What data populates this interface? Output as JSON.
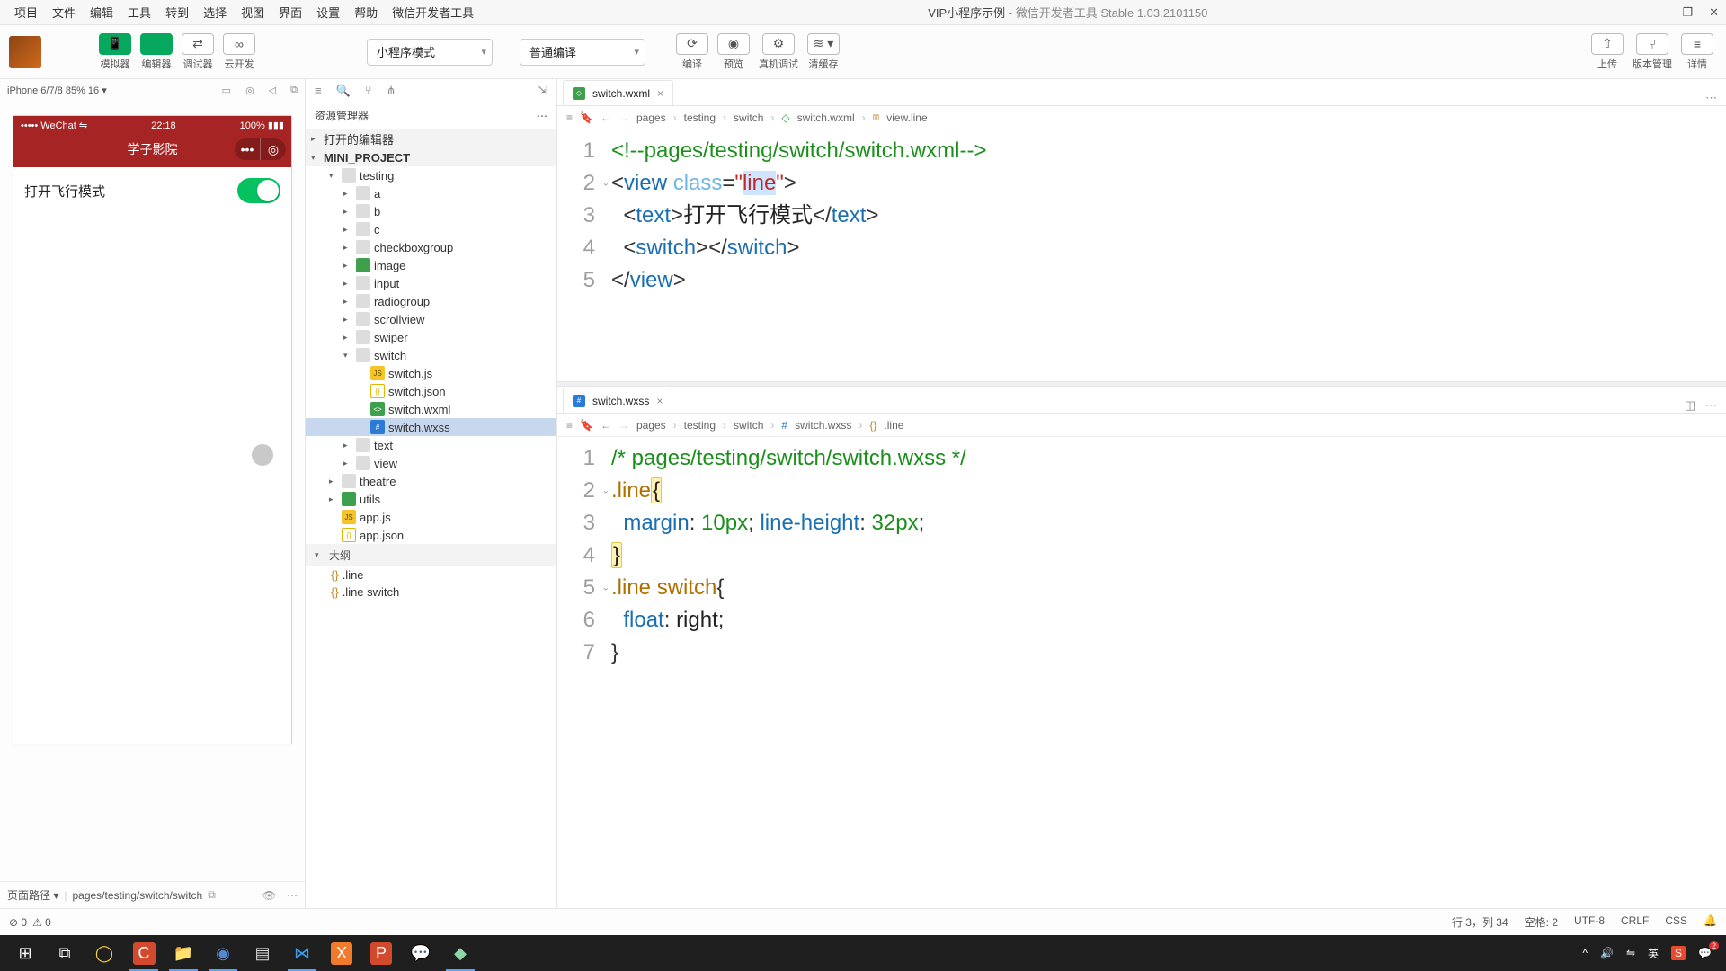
{
  "menu": {
    "items": [
      "项目",
      "文件",
      "编辑",
      "工具",
      "转到",
      "选择",
      "视图",
      "界面",
      "设置",
      "帮助",
      "微信开发者工具"
    ],
    "title_project": "VIP小程序示例",
    "title_suffix": " - 微信开发者工具 Stable 1.03.2101150"
  },
  "win": {
    "min": "—",
    "max": "❐",
    "close": "✕"
  },
  "toolbar": {
    "group1": [
      {
        "name": "simulator",
        "label": "模拟器",
        "icon": "📱",
        "green": true
      },
      {
        "name": "editor",
        "label": "编辑器",
        "icon": "</>",
        "green": true
      },
      {
        "name": "debugger",
        "label": "调试器",
        "icon": "⇄",
        "green": false
      },
      {
        "name": "cloud",
        "label": "云开发",
        "icon": "∞",
        "green": false
      }
    ],
    "mode": "小程序模式",
    "compile": "普通编译",
    "group2": [
      {
        "name": "compile",
        "label": "编译",
        "icon": "⟳"
      },
      {
        "name": "preview",
        "label": "预览",
        "icon": "◉"
      },
      {
        "name": "remote-debug",
        "label": "真机调试",
        "icon": "⚙"
      },
      {
        "name": "clear-cache",
        "label": "清缓存",
        "icon": "≋ ▾"
      }
    ],
    "group3": [
      {
        "name": "upload",
        "label": "上传",
        "icon": "⇧"
      },
      {
        "name": "version",
        "label": "版本管理",
        "icon": "⑂"
      },
      {
        "name": "detail",
        "label": "详情",
        "icon": "≡"
      }
    ]
  },
  "sim": {
    "device": "iPhone 6/7/8 85% 16 ▾",
    "icons": [
      "▭",
      "◎",
      "◁",
      "⧉"
    ],
    "status_left": "••••• WeChat ⇋",
    "status_time": "22:18",
    "status_right": "100% ▮▮▮",
    "app_title": "学子影院",
    "line_text": "打开飞行模式",
    "path_label": "页面路径 ▾",
    "path": "pages/testing/switch/switch"
  },
  "explorer": {
    "title": "资源管理器",
    "sections": {
      "open_editors": "打开的编辑器",
      "project": "MINI_PROJECT",
      "outline": "大纲"
    },
    "tree": [
      {
        "d": 1,
        "chev": "▾",
        "ic": "folder",
        "t": "testing"
      },
      {
        "d": 2,
        "chev": "▸",
        "ic": "folder",
        "t": "a"
      },
      {
        "d": 2,
        "chev": "▸",
        "ic": "folder",
        "t": "b"
      },
      {
        "d": 2,
        "chev": "▸",
        "ic": "folder",
        "t": "c"
      },
      {
        "d": 2,
        "chev": "▸",
        "ic": "folder",
        "t": "checkboxgroup"
      },
      {
        "d": 2,
        "chev": "▸",
        "ic": "fold-g",
        "t": "image"
      },
      {
        "d": 2,
        "chev": "▸",
        "ic": "folder",
        "t": "input"
      },
      {
        "d": 2,
        "chev": "▸",
        "ic": "folder",
        "t": "radiogroup"
      },
      {
        "d": 2,
        "chev": "▸",
        "ic": "folder",
        "t": "scrollview"
      },
      {
        "d": 2,
        "chev": "▸",
        "ic": "folder",
        "t": "swiper"
      },
      {
        "d": 2,
        "chev": "▾",
        "ic": "folder",
        "t": "switch"
      },
      {
        "d": 3,
        "chev": "",
        "ic": "js",
        "t": "switch.js"
      },
      {
        "d": 3,
        "chev": "",
        "ic": "json",
        "t": "switch.json"
      },
      {
        "d": 3,
        "chev": "",
        "ic": "wxml",
        "t": "switch.wxml"
      },
      {
        "d": 3,
        "chev": "",
        "ic": "wxss",
        "t": "switch.wxss",
        "sel": true
      },
      {
        "d": 2,
        "chev": "▸",
        "ic": "folder",
        "t": "text"
      },
      {
        "d": 2,
        "chev": "▸",
        "ic": "folder",
        "t": "view"
      },
      {
        "d": 1,
        "chev": "▸",
        "ic": "folder",
        "t": "theatre"
      },
      {
        "d": 1,
        "chev": "▸",
        "ic": "fold-g",
        "t": "utils"
      },
      {
        "d": 1,
        "chev": "",
        "ic": "js",
        "t": "app.js"
      },
      {
        "d": 1,
        "chev": "",
        "ic": "json",
        "t": "app.json"
      }
    ],
    "outline": [
      {
        "ic": "{}",
        "t": ".line"
      },
      {
        "ic": "{}",
        "t": ".line switch"
      }
    ]
  },
  "editor1": {
    "tab": "switch.wxml",
    "crumbs": [
      "pages",
      "testing",
      "switch",
      "switch.wxml",
      "view.line"
    ],
    "code": [
      {
        "n": 1,
        "h": "<span class='tok-com'>&lt;!--pages/testing/switch/switch.wxml--&gt;</span>"
      },
      {
        "n": 2,
        "fold": "⌄",
        "h": "<span class='tok-punct'>&lt;</span><span class='tok-tag'>view</span> <span class='tok-attr'>class</span><span class='tok-punct'>=</span><span class='tok-str'>\"<span class='hl-sel'>line</span>\"</span><span class='tok-punct'>&gt;</span>"
      },
      {
        "n": 3,
        "h": "  <span class='tok-punct'>&lt;</span><span class='tok-tag'>text</span><span class='tok-punct'>&gt;</span><span class='tok-txt'>打开飞行模式</span><span class='tok-punct'>&lt;/</span><span class='tok-tag'>text</span><span class='tok-punct'>&gt;</span>"
      },
      {
        "n": 4,
        "h": "  <span class='tok-punct'>&lt;</span><span class='tok-tag'>switch</span><span class='tok-punct'>&gt;&lt;/</span><span class='tok-tag'>switch</span><span class='tok-punct'>&gt;</span>"
      },
      {
        "n": 5,
        "h": "<span class='tok-punct'>&lt;/</span><span class='tok-tag'>view</span><span class='tok-punct'>&gt;</span>"
      }
    ]
  },
  "editor2": {
    "tab": "switch.wxss",
    "crumbs": [
      "pages",
      "testing",
      "switch",
      "switch.wxss",
      ".line"
    ],
    "code": [
      {
        "n": 1,
        "h": "<span class='tok-com'>/* pages/testing/switch/switch.wxss */</span>"
      },
      {
        "n": 2,
        "fold": "⌄",
        "h": "<span class='tok-sel'>.line</span><span class='hl-y'>{</span>"
      },
      {
        "n": 3,
        "h": "  <span class='tok-prop'>margin</span><span class='tok-punct'>:</span> <span class='tok-num'>10px</span><span class='tok-punct'>;</span> <span class='tok-prop'>line-height</span><span class='tok-punct'>:</span> <span class='tok-num'>32px</span><span class='tok-punct'>;</span>"
      },
      {
        "n": 4,
        "h": "<span class='hl-y'>}</span>"
      },
      {
        "n": 5,
        "fold": "⌄",
        "h": "<span class='tok-sel'>.line</span> <span class='tok-sel'>switch</span><span class='tok-brace'>{</span>"
      },
      {
        "n": 6,
        "h": "  <span class='tok-prop'>float</span><span class='tok-punct'>:</span> <span class='tok-txt'>right</span><span class='tok-punct'>;</span>"
      },
      {
        "n": 7,
        "h": "<span class='tok-brace'>}</span>"
      }
    ]
  },
  "status_exp": {
    "err": "⊘ 0",
    "warn": "⚠ 0"
  },
  "status_ed": {
    "pos": "行 3，列 34",
    "spaces": "空格: 2",
    "enc": "UTF-8",
    "eol": "CRLF",
    "lang": "CSS",
    "bell": "🔔"
  },
  "taskbar": {
    "items": [
      {
        "name": "start",
        "glyph": "⊞",
        "c": "#fff"
      },
      {
        "name": "taskview",
        "glyph": "⧉",
        "c": "#fff"
      },
      {
        "name": "cortana",
        "glyph": "◯",
        "c": "#ffd24a"
      },
      {
        "name": "camtasia",
        "glyph": "C",
        "c": "#fff",
        "bg": "#d24a2d",
        "active": true
      },
      {
        "name": "explorer",
        "glyph": "📁",
        "c": "#ffd76a",
        "active": true
      },
      {
        "name": "chrome",
        "glyph": "◉",
        "c": "#58c",
        "active": true
      },
      {
        "name": "notes",
        "glyph": "▤",
        "c": "#ddd"
      },
      {
        "name": "vscode",
        "glyph": "⋈",
        "c": "#3aa0f0",
        "active": true
      },
      {
        "name": "xampp",
        "glyph": "X",
        "c": "#fff",
        "bg": "#f07b2d"
      },
      {
        "name": "ppt",
        "glyph": "P",
        "c": "#fff",
        "bg": "#d24a2d"
      },
      {
        "name": "wechat",
        "glyph": "💬",
        "c": "#ddd"
      },
      {
        "name": "devtool",
        "glyph": "◆",
        "c": "#8fd6a8",
        "active": true
      }
    ],
    "tray": {
      "arrow": "^",
      "vol": "🔊",
      "wifi": "⇋",
      "ime": "英",
      "sogou": "S",
      "notif": "💬",
      "notif_count": "2"
    }
  }
}
